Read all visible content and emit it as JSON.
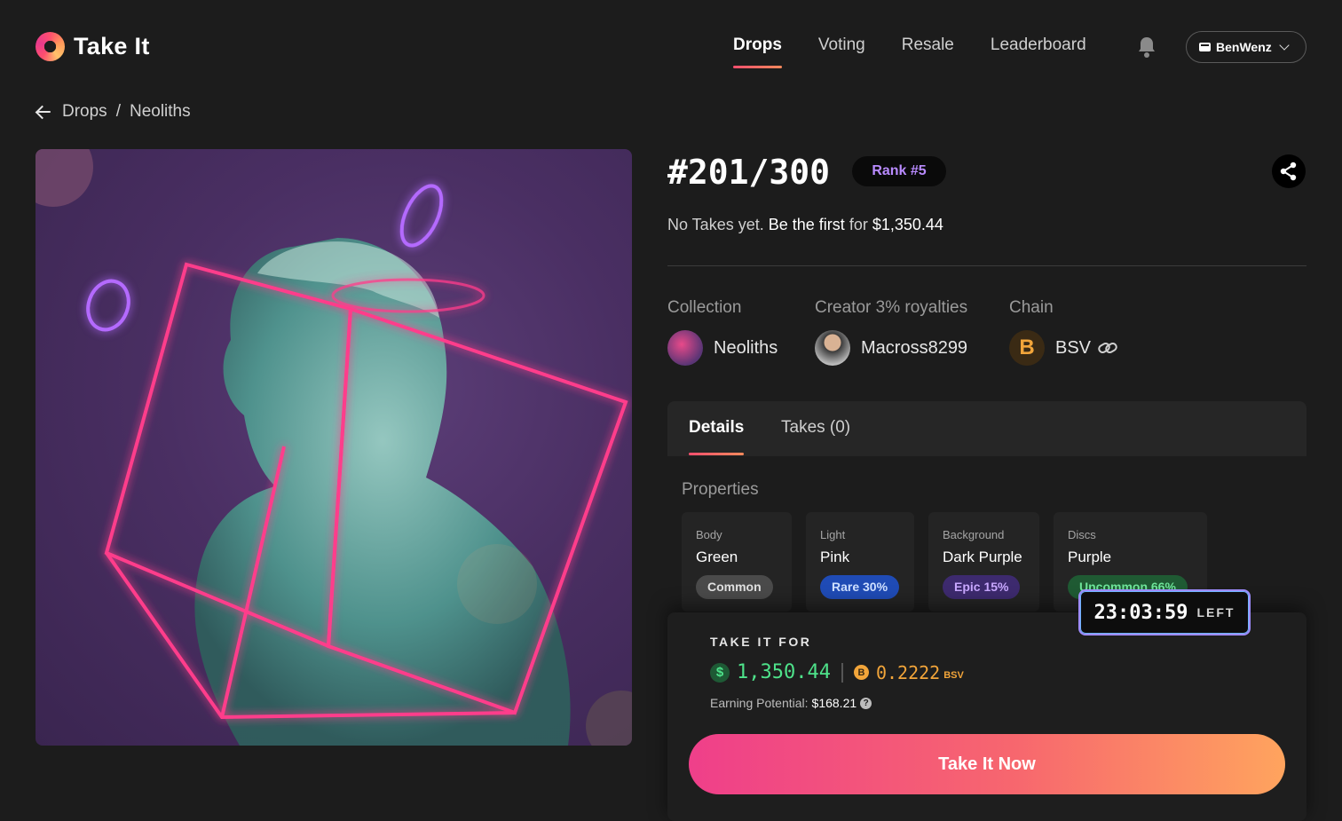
{
  "app": {
    "brand": "Take It"
  },
  "nav": {
    "items": [
      {
        "label": "Drops",
        "active": true
      },
      {
        "label": "Voting",
        "active": false
      },
      {
        "label": "Resale",
        "active": false
      },
      {
        "label": "Leaderboard",
        "active": false
      }
    ],
    "user": "BenWenz"
  },
  "breadcrumb": {
    "parent": "Drops",
    "separator": "/",
    "current": "Neoliths"
  },
  "item": {
    "title": "#201/300",
    "rank": "Rank #5",
    "no_takes_prefix": "No Takes yet.",
    "no_takes_cta": "Be the first",
    "no_takes_for": "for",
    "no_takes_price": "$1,350.44"
  },
  "meta": {
    "collection_label": "Collection",
    "collection_value": "Neoliths",
    "creator_label": "Creator 3% royalties",
    "creator_value": "Macross8299",
    "chain_label": "Chain",
    "chain_value": "BSV",
    "chain_symbol": "B"
  },
  "tabs": [
    {
      "label": "Details",
      "active": true
    },
    {
      "label": "Takes (0)",
      "active": false
    }
  ],
  "properties": {
    "title": "Properties",
    "items": [
      {
        "type": "Body",
        "value": "Green",
        "rarity": "Common",
        "rarity_color": "#4a4a4a",
        "rarity_text_color": "#e0e0e0"
      },
      {
        "type": "Light",
        "value": "Pink",
        "rarity": "Rare 30%",
        "rarity_color": "#1f4bb5",
        "rarity_text_color": "#cfe0ff"
      },
      {
        "type": "Background",
        "value": "Dark Purple",
        "rarity": "Epic 15%",
        "rarity_color": "#3d2a6e",
        "rarity_text_color": "#c9a8ff"
      },
      {
        "type": "Discs",
        "value": "Purple",
        "rarity": "Uncommon 66%",
        "rarity_color": "#1f5a33",
        "rarity_text_color": "#6ee59a"
      }
    ]
  },
  "timer": {
    "value": "23:03:59",
    "suffix": "LEFT"
  },
  "take": {
    "label": "TAKE IT FOR",
    "usd_symbol": "$",
    "usd": "1,350.44",
    "bsv_symbol": "B",
    "bsv": "0.2222",
    "bsv_unit": "BSV",
    "earning_label": "Earning Potential:",
    "earning_value": "$168.21",
    "help": "?",
    "cta": "Take It Now"
  }
}
